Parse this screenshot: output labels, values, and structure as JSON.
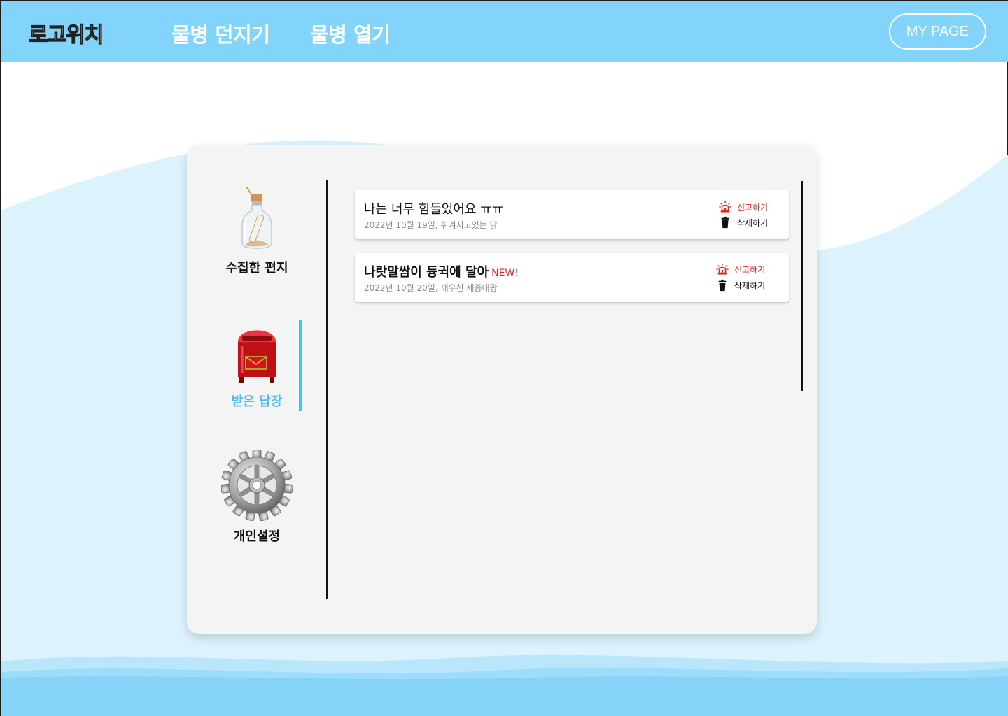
{
  "header": {
    "logo": "로고위치",
    "nav": [
      {
        "label": "물병 던지기"
      },
      {
        "label": "물병 열기"
      }
    ],
    "mypage_label": "MY PAGE"
  },
  "sidebar": {
    "items": [
      {
        "label": "수집한 편지",
        "icon": "bottle-letter-icon",
        "active": false
      },
      {
        "label": "받은 답장",
        "icon": "mailbox-icon",
        "active": true
      },
      {
        "label": "개인설정",
        "icon": "gear-icon",
        "active": false
      }
    ]
  },
  "letters": [
    {
      "title": "나는 너무 힘들었어요 ㅠㅠ",
      "meta": "2022년 10월 19일, 튀겨지고있는 닭",
      "is_new": false,
      "report_label": "신고하기",
      "delete_label": "삭제하기"
    },
    {
      "title": "나랏말쌈이 듕귁에 달아",
      "new_label": "NEW!",
      "meta": "2022년 10월 20일, 깨우친 세종대왕",
      "is_new": true,
      "report_label": "신고하기",
      "delete_label": "삭제하기"
    }
  ],
  "colors": {
    "header_bg": "#82d4fa",
    "accent": "#4cbdf0",
    "report": "#e02424",
    "card_bg": "#f4f4f4"
  }
}
